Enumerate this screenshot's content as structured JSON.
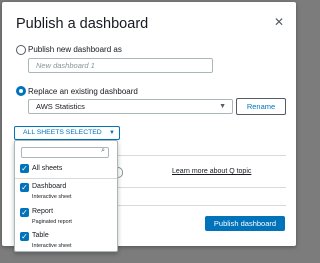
{
  "dialog": {
    "title": "Publish a dashboard",
    "close_icon": "close-icon"
  },
  "publish_new": {
    "label": "Publish new dashboard as",
    "placeholder": "New dashboard 1",
    "selected": false
  },
  "replace_existing": {
    "label": "Replace an existing dashboard",
    "selected": true,
    "selected_value": "AWS Statistics",
    "rename_label": "Rename"
  },
  "sheets_selector": {
    "label": "ALL SHEETS SELECTED",
    "options": [
      {
        "label": "All sheets",
        "sublabel": "",
        "checked": true
      },
      {
        "label": "Dashboard",
        "sublabel": "Interactive sheet",
        "checked": true
      },
      {
        "label": "Report",
        "sublabel": "Paginated report",
        "checked": true
      },
      {
        "label": "Table",
        "sublabel": "Interactive sheet",
        "checked": true
      }
    ]
  },
  "q_topic": {
    "link_text": "Learn more about Q topic"
  },
  "footer": {
    "publish_label": "Publish dashboard"
  },
  "colors": {
    "accent": "#0073bb",
    "overlay": "#7c7c7c",
    "text": "#16191f"
  }
}
